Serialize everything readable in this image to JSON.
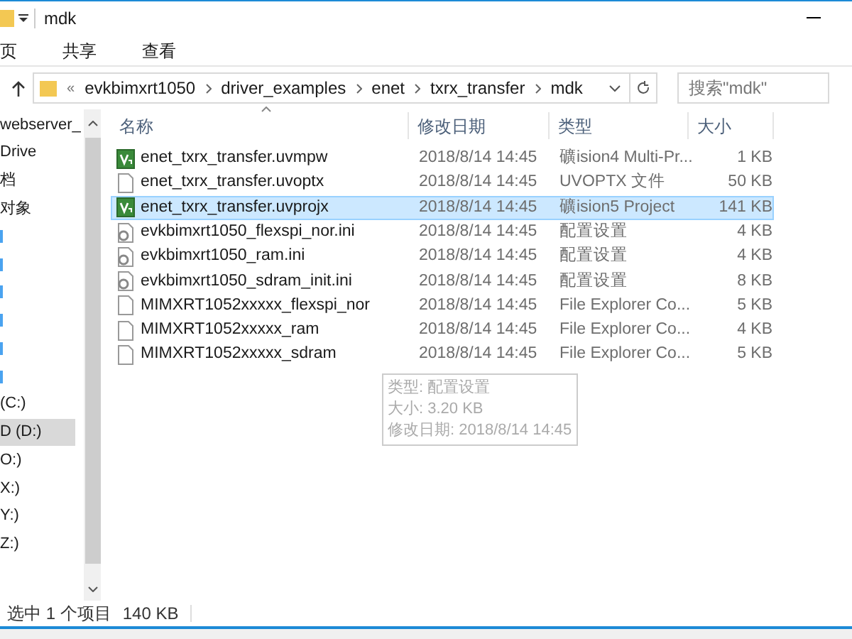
{
  "window": {
    "title": "mdk"
  },
  "ribbon_tabs": [
    {
      "label": "页",
      "selected": false
    },
    {
      "label": "共享",
      "selected": false
    },
    {
      "label": "查看",
      "selected": false
    }
  ],
  "address": {
    "overflow": "«",
    "crumbs": [
      "evkbimxrt1050",
      "driver_examples",
      "enet",
      "txrx_transfer",
      "mdk"
    ]
  },
  "search": {
    "placeholder": "搜索\"mdk\""
  },
  "sidebar": {
    "items": [
      {
        "label": "webserver_",
        "selected": false
      },
      {
        "label": "Drive",
        "selected": false
      },
      {
        "label": "档",
        "selected": false
      },
      {
        "label": "对象",
        "selected": false
      },
      {
        "selected": false,
        "kind": "mark"
      },
      {
        "selected": false,
        "kind": "mark"
      },
      {
        "selected": false,
        "kind": "mark"
      },
      {
        "selected": false,
        "kind": "mark"
      },
      {
        "selected": false,
        "kind": "mark"
      },
      {
        "selected": false,
        "kind": "mark"
      },
      {
        "label": "(C:)",
        "selected": false
      },
      {
        "label": "D (D:)",
        "selected": true
      },
      {
        "label": "O:)",
        "selected": false
      },
      {
        "label": "X:)",
        "selected": false
      },
      {
        "label": "Y:)",
        "selected": false
      },
      {
        "label": "Z:)",
        "selected": false
      }
    ]
  },
  "table": {
    "columns": [
      "名称",
      "修改日期",
      "类型",
      "大小"
    ],
    "rows": [
      {
        "kind": "uvision",
        "name": "enet_txrx_transfer.uvmpw",
        "date": "2018/8/14 14:45",
        "type": "礦ision4 Multi-Pr...",
        "size": "1 KB",
        "selected": false
      },
      {
        "kind": "blank",
        "name": "enet_txrx_transfer.uvoptx",
        "date": "2018/8/14 14:45",
        "type": "UVOPTX 文件",
        "size": "50 KB",
        "selected": false
      },
      {
        "kind": "uvision",
        "name": "enet_txrx_transfer.uvprojx",
        "date": "2018/8/14 14:45",
        "type": "礦ision5 Project",
        "size": "141 KB",
        "selected": true
      },
      {
        "kind": "ini",
        "name": "evkbimxrt1050_flexspi_nor.ini",
        "date": "2018/8/14 14:45",
        "type": "配置设置",
        "size": "4 KB",
        "selected": false
      },
      {
        "kind": "ini",
        "name": "evkbimxrt1050_ram.ini",
        "date": "2018/8/14 14:45",
        "type": "配置设置",
        "size": "4 KB",
        "selected": false
      },
      {
        "kind": "ini",
        "name": "evkbimxrt1050_sdram_init.ini",
        "date": "2018/8/14 14:45",
        "type": "配置设置",
        "size": "8 KB",
        "selected": false
      },
      {
        "kind": "blank",
        "name": "MIMXRT1052xxxxx_flexspi_nor",
        "date": "2018/8/14 14:45",
        "type": "File Explorer Co...",
        "size": "5 KB",
        "selected": false
      },
      {
        "kind": "blank",
        "name": "MIMXRT1052xxxxx_ram",
        "date": "2018/8/14 14:45",
        "type": "File Explorer Co...",
        "size": "4 KB",
        "selected": false
      },
      {
        "kind": "blank",
        "name": "MIMXRT1052xxxxx_sdram",
        "date": "2018/8/14 14:45",
        "type": "File Explorer Co...",
        "size": "5 KB",
        "selected": false
      }
    ]
  },
  "tooltip": {
    "lines": [
      "类型: 配置设置",
      "大小: 3.20 KB",
      "修改日期: 2018/8/14 14:45"
    ]
  },
  "status_bar": {
    "count": "选中 1 个项目",
    "size": "140 KB"
  }
}
